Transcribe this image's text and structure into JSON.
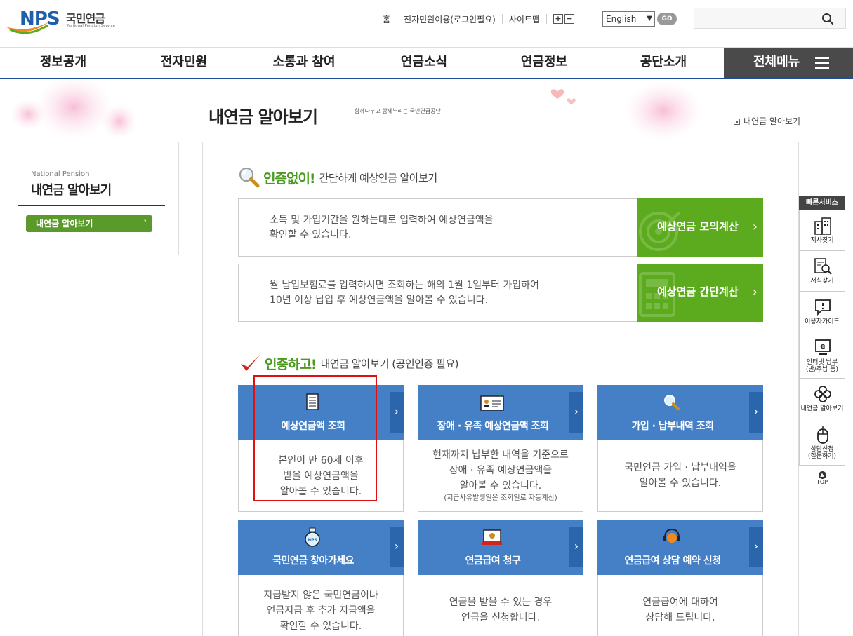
{
  "header": {
    "logo_text": "NPS",
    "logo_korean": "국민연금",
    "logo_english": "National Pension Service",
    "util_links": [
      "홈",
      "전자민원이용(로그인필요)",
      "사이트맵"
    ],
    "zoom_in": "+",
    "zoom_out": "−",
    "language": "English",
    "go_label": "GO",
    "search_placeholder": ""
  },
  "nav": {
    "items": [
      "정보공개",
      "전자민원",
      "소통과 참여",
      "연금소식",
      "연금정보",
      "공단소개"
    ],
    "all_menu": "전체메뉴"
  },
  "page": {
    "title": "내연금 알아보기",
    "subtitle": "함께나누고 함께누리는 국민연금공단!",
    "breadcrumb": "내연금 알아보기"
  },
  "lnb": {
    "en": "National Pension",
    "title": "내연금 알아보기",
    "button": "내연금 알아보기"
  },
  "section1": {
    "strong": "인증없이!",
    "rest": "간단하게 예상연금 알아보기",
    "boxes": [
      {
        "text1": "소득 및 가입기간을 원하는대로 입력하여 예상연금액을",
        "text2": "확인할 수 있습니다.",
        "button": "예상연금 모의계산"
      },
      {
        "text1": "월 납입보험료를 입력하시면 조회하는 해의 1월 1일부터 가입하여",
        "text2": "10년 이상 납입 후 예상연금액을 알아볼 수 있습니다.",
        "button": "예상연금 간단계산"
      }
    ]
  },
  "section2": {
    "strong": "인증하고!",
    "rest": "내연금 알아보기 (공인인증 필요)",
    "cards": [
      {
        "title": "예상연금액 조회",
        "desc": [
          "본인이 만 60세 이후",
          "받을 예상연금액을",
          "알아볼 수 있습니다."
        ],
        "note": ""
      },
      {
        "title": "장애 · 유족 예상연금액 조회",
        "desc": [
          "현재까지 납부한 내역을 기준으로",
          "장애 · 유족 예상연금액을",
          "알아볼 수 있습니다."
        ],
        "note": "(지급사유발생일은 조회일로 자동계산)"
      },
      {
        "title": "가입 · 납부내역 조회",
        "desc": [
          "국민연금 가입 · 납부내역을",
          "알아볼 수 있습니다."
        ],
        "note": ""
      },
      {
        "title": "국민연금 찾아가세요",
        "desc": [
          "지급받지 않은 국민연금이나",
          "연금지급 후 추가 지급액을",
          "확인할 수 있습니다."
        ],
        "note": ""
      },
      {
        "title": "연금급여 청구",
        "desc": [
          "연금을 받을 수 있는 경우",
          "연금을 신청합니다."
        ],
        "note": ""
      },
      {
        "title": "연금급여 상담 예약 신청",
        "desc": [
          "연금급여에 대하여",
          "상담해 드립니다."
        ],
        "note": ""
      }
    ]
  },
  "quick": {
    "title": "빠른서비스",
    "items": [
      {
        "label": "지사찾기"
      },
      {
        "label": "서식찾기"
      },
      {
        "label": "이용자가이드"
      },
      {
        "label1": "인터넷 납부",
        "label2": "(반/추납 등)"
      },
      {
        "label": "내연금 알아보기"
      },
      {
        "label1": "상담신청",
        "label2": "(질문하기)"
      }
    ],
    "top": "TOP",
    "top_icon": "▲"
  },
  "icons": {
    "chevron": "›",
    "select_arrow": "▼",
    "lnb_arrow": "˅"
  },
  "colors": {
    "brand_blue": "#1d5fa8",
    "green": "#5cab1e",
    "card_blue": "#4580c6",
    "highlight": "#e01010"
  }
}
